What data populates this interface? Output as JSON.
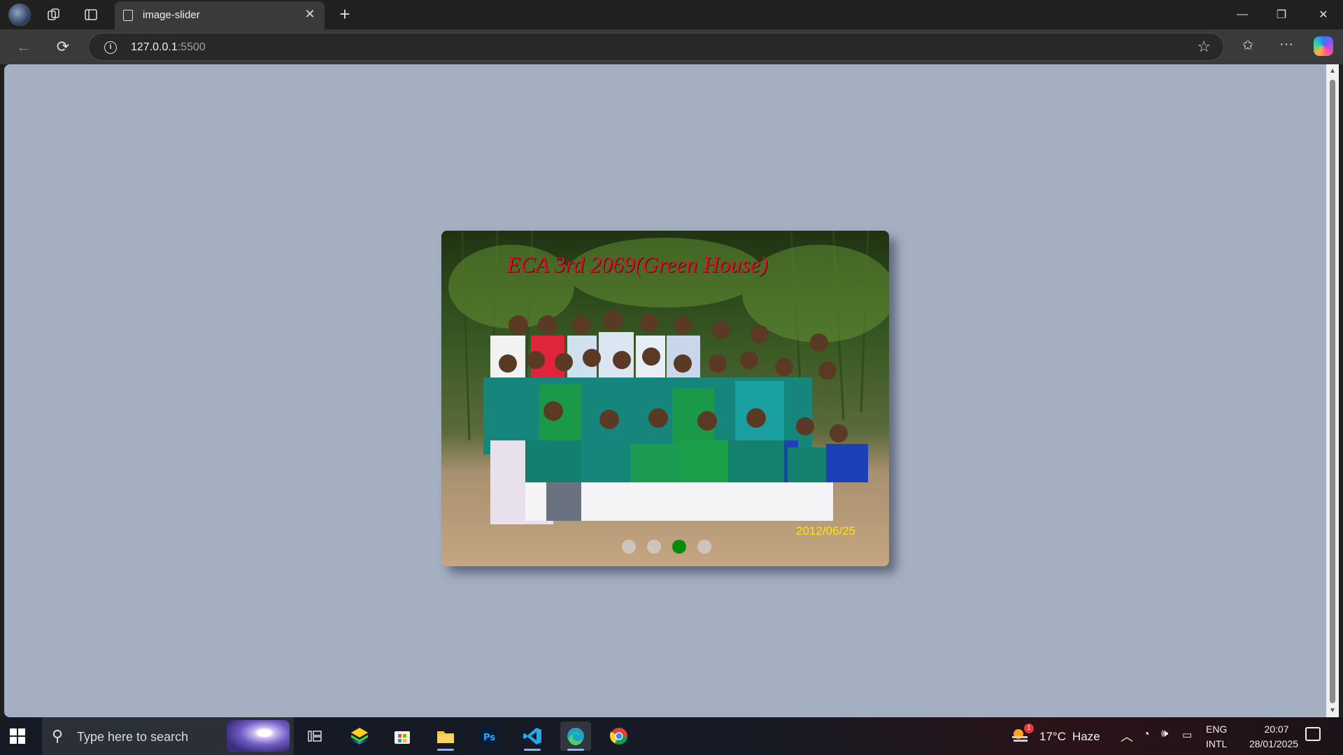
{
  "browser": {
    "tab_title": "image-slider",
    "url_host": "127.0.0.1",
    "url_port": ":5500"
  },
  "slider": {
    "caption": "ECA 3rd 2069(Green House)",
    "date_stamp": "2012/06/25",
    "slide_count": 4,
    "active_slide_index": 2
  },
  "taskbar": {
    "search_placeholder": "Type here to search",
    "weather_temp": "17°C",
    "weather_desc": "Haze",
    "weather_badge": "1",
    "lang_primary": "ENG",
    "lang_secondary": "INTL",
    "time": "20:07",
    "date": "28/01/2025"
  },
  "colors": {
    "page_bg": "#a4b0c1",
    "caption_color": "#e0102a",
    "active_dot": "#0a8a0a",
    "date_stamp_color": "#ffe11a"
  }
}
